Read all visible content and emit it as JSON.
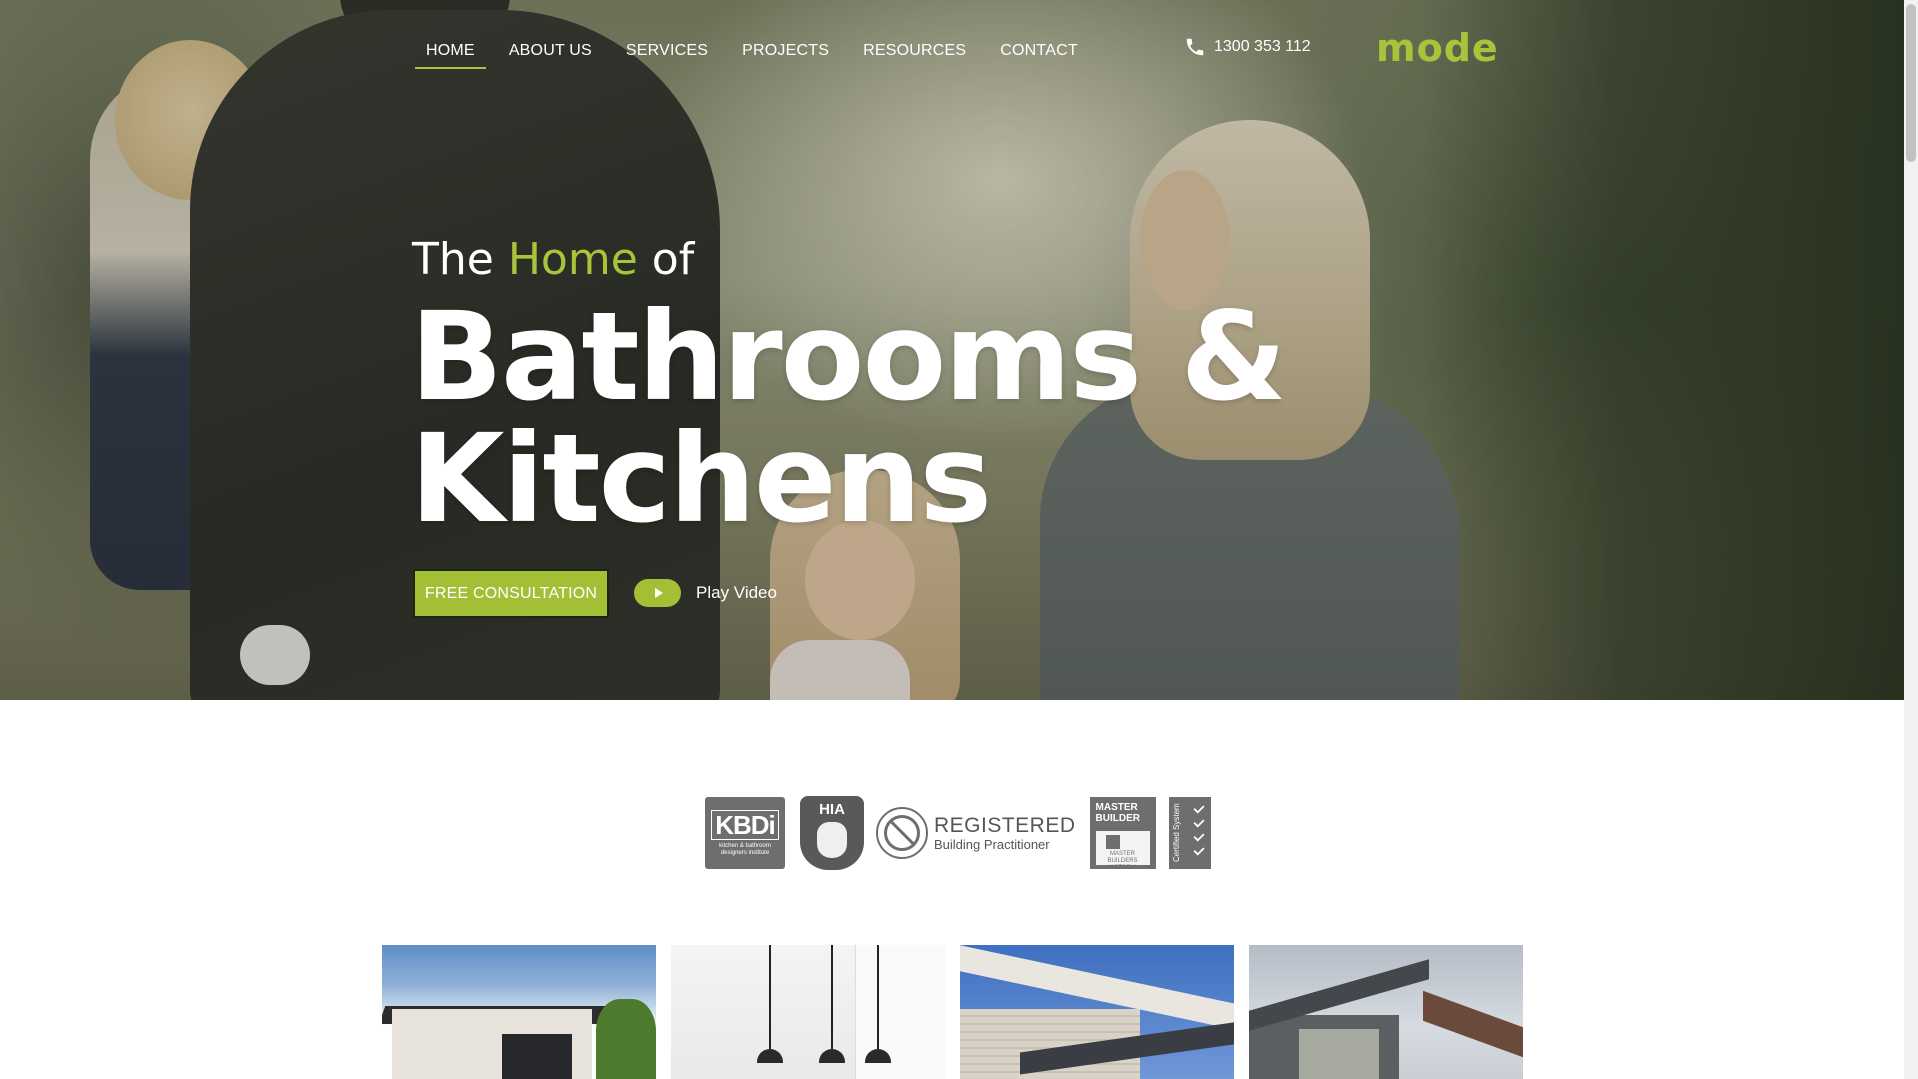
{
  "nav": {
    "items": [
      {
        "label": "HOME",
        "active": true
      },
      {
        "label": "ABOUT US",
        "active": false
      },
      {
        "label": "SERVICES",
        "active": false
      },
      {
        "label": "PROJECTS",
        "active": false
      },
      {
        "label": "RESOURCES",
        "active": false
      },
      {
        "label": "CONTACT",
        "active": false
      }
    ],
    "phone": "1300 353 112",
    "logo": "mode"
  },
  "hero": {
    "sub_pre": "The",
    "sub_accent": "Home",
    "sub_post": "of",
    "title_line1": "Bathrooms &",
    "title_line2": "Kitchens",
    "cta_label": "FREE CONSULTATION",
    "play_label": "Play Video"
  },
  "badges": {
    "kbdi": {
      "mark": "KBDi",
      "caption": "kitchen & bathroom designers institute"
    },
    "hia": {
      "mark": "HIA"
    },
    "registered": {
      "line1": "REGISTERED",
      "line2": "Building Practitioner"
    },
    "master_builder": {
      "line1": "MASTER",
      "line2": "BUILDER",
      "box": "MASTER BUILDERS VICTORIA"
    },
    "certified": {
      "label": "Certified System"
    }
  },
  "colors": {
    "accent": "#a8c43a",
    "button": "#a3bf36",
    "badge_grey": "#6d6e6f"
  },
  "icons": {
    "phone": "phone-icon",
    "play": "play-icon"
  }
}
